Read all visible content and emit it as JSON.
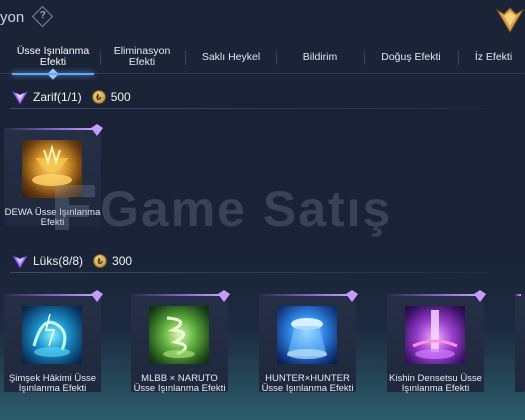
{
  "header": {
    "title": "yon",
    "help_symbol": "?"
  },
  "tabs": [
    {
      "label": "Üsse Işınlanma Efekti",
      "active": true
    },
    {
      "label": "Eliminasyon Efekti",
      "active": false
    },
    {
      "label": "Saklı Heykel",
      "active": false
    },
    {
      "label": "Bildirim",
      "active": false
    },
    {
      "label": "Doğuş Efekti",
      "active": false
    },
    {
      "label": "İz Efekti",
      "active": false
    }
  ],
  "sections": [
    {
      "name": "Zarif(1/1)",
      "price": "500",
      "items": [
        {
          "label": "DEWA Üsse Işınlanma Efekti",
          "art": "golden-chalice"
        }
      ]
    },
    {
      "name": "Lüks(8/8)",
      "price": "300",
      "items": [
        {
          "label": "Şimşek Hâkimi Üsse Işınlanma Efekti",
          "art": "lightning-dragon"
        },
        {
          "label": "MLBB × NARUTO Üsse Işınlanma Efekti",
          "art": "green-whirlwind"
        },
        {
          "label": "HUNTER×HUNTER Üsse Işınlanma Efekti",
          "art": "blue-ufo-beam"
        },
        {
          "label": "Kishin Densetsu Üsse Işınlanma Efekti",
          "art": "purple-pillar"
        }
      ]
    }
  ],
  "watermark": "Game Satış",
  "colors": {
    "accent": "#5fa8ff",
    "rarity_purple": "#9c6bff",
    "coin_gold": "#d9b25a"
  }
}
